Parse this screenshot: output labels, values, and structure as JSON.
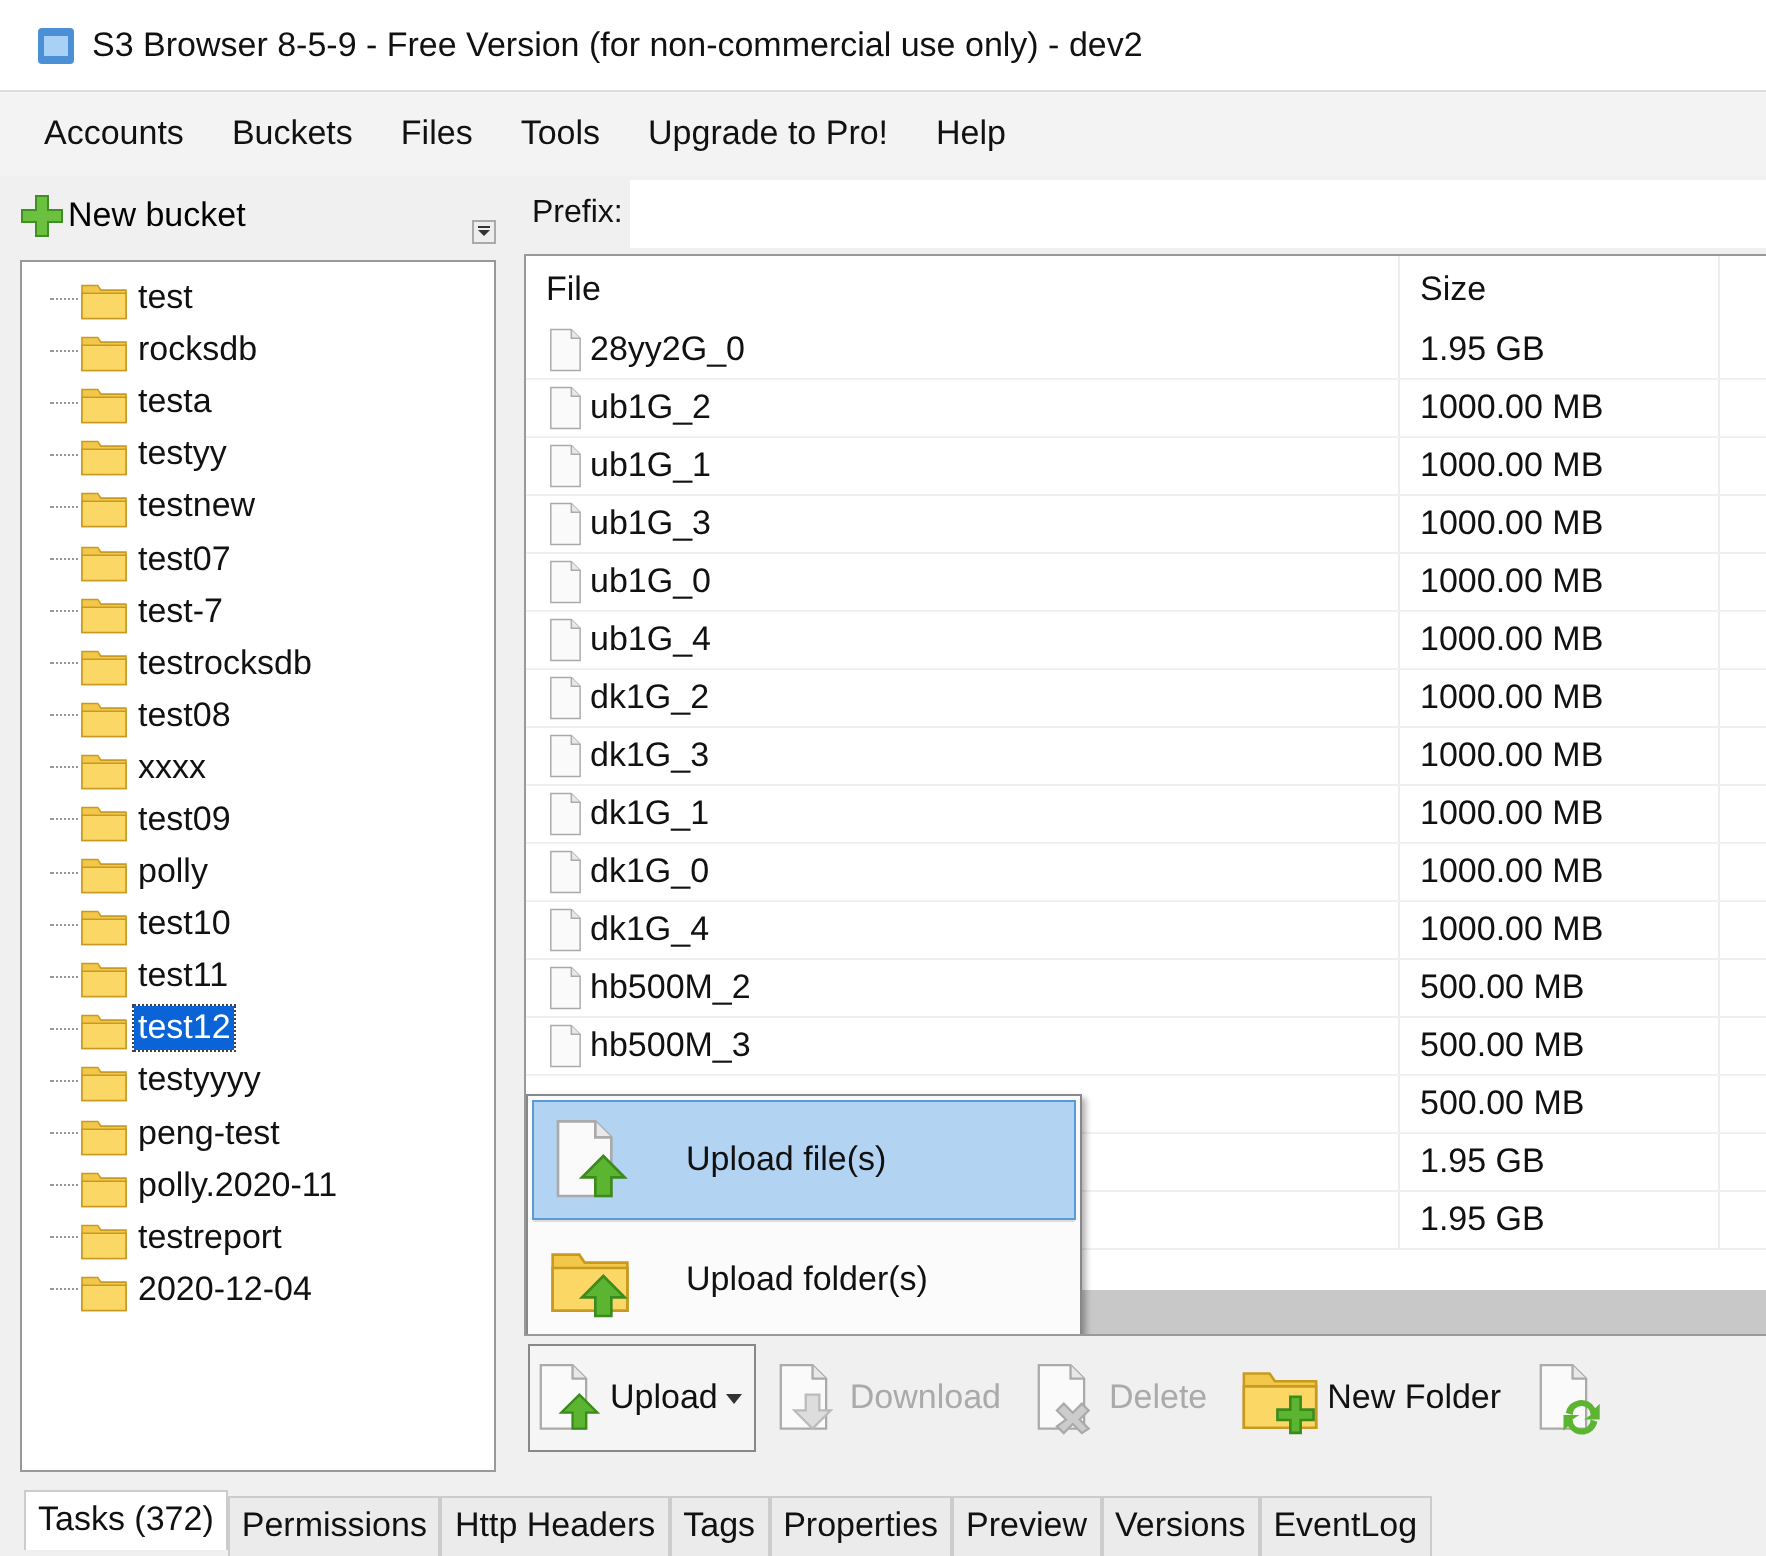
{
  "window": {
    "title": "S3 Browser 8-5-9 - Free Version (for non-commercial use only) - dev2"
  },
  "menu": [
    "Accounts",
    "Buckets",
    "Files",
    "Tools",
    "Upgrade to Pro!",
    "Help"
  ],
  "sidebar": {
    "new_bucket": "New bucket",
    "items": [
      {
        "label": "test",
        "selected": false
      },
      {
        "label": "rocksdb",
        "selected": false
      },
      {
        "label": "testa",
        "selected": false
      },
      {
        "label": "testyy",
        "selected": false
      },
      {
        "label": "testnew",
        "selected": false
      },
      {
        "label": "test07",
        "selected": false
      },
      {
        "label": "test-7",
        "selected": false
      },
      {
        "label": "testrocksdb",
        "selected": false
      },
      {
        "label": "test08",
        "selected": false
      },
      {
        "label": "xxxx",
        "selected": false
      },
      {
        "label": "test09",
        "selected": false
      },
      {
        "label": "polly",
        "selected": false
      },
      {
        "label": "test10",
        "selected": false
      },
      {
        "label": "test11",
        "selected": false
      },
      {
        "label": "test12",
        "selected": true
      },
      {
        "label": "testyyyy",
        "selected": false
      },
      {
        "label": "peng-test",
        "selected": false
      },
      {
        "label": "polly.2020-11",
        "selected": false
      },
      {
        "label": "testreport",
        "selected": false
      },
      {
        "label": "2020-12-04",
        "selected": false
      }
    ]
  },
  "prefix": {
    "label": "Prefix:"
  },
  "table": {
    "columns": [
      "File",
      "Size"
    ],
    "rows": [
      {
        "file": "28yy2G_0",
        "size": "1.95 GB"
      },
      {
        "file": "ub1G_2",
        "size": "1000.00 MB"
      },
      {
        "file": "ub1G_1",
        "size": "1000.00 MB"
      },
      {
        "file": "ub1G_3",
        "size": "1000.00 MB"
      },
      {
        "file": "ub1G_0",
        "size": "1000.00 MB"
      },
      {
        "file": "ub1G_4",
        "size": "1000.00 MB"
      },
      {
        "file": "dk1G_2",
        "size": "1000.00 MB"
      },
      {
        "file": "dk1G_3",
        "size": "1000.00 MB"
      },
      {
        "file": "dk1G_1",
        "size": "1000.00 MB"
      },
      {
        "file": "dk1G_0",
        "size": "1000.00 MB"
      },
      {
        "file": "dk1G_4",
        "size": "1000.00 MB"
      },
      {
        "file": "hb500M_2",
        "size": "500.00 MB"
      },
      {
        "file": "hb500M_3",
        "size": "500.00 MB"
      },
      {
        "size": "500.00 MB"
      },
      {
        "size": "1.95 GB"
      },
      {
        "size": "1.95 GB"
      }
    ]
  },
  "upload_menu": [
    {
      "label": "Upload file(s)",
      "kind": "file",
      "selected": true
    },
    {
      "label": "Upload folder(s)",
      "kind": "folder",
      "selected": false
    }
  ],
  "toolbar": [
    {
      "label": "Upload",
      "kind": "upload",
      "disabled": false
    },
    {
      "label": "Download",
      "kind": "download",
      "disabled": true
    },
    {
      "label": "Delete",
      "kind": "delete",
      "disabled": true
    },
    {
      "label": "New Folder",
      "kind": "newfolder",
      "disabled": false
    },
    {
      "kind": "refresh"
    }
  ],
  "tabs": [
    {
      "label": "Tasks (372)",
      "selected": true
    },
    {
      "label": "Permissions",
      "selected": false
    },
    {
      "label": "Http Headers",
      "selected": false
    },
    {
      "label": "Tags",
      "selected": false
    },
    {
      "label": "Properties",
      "selected": false
    },
    {
      "label": "Preview",
      "selected": false
    },
    {
      "label": "Versions",
      "selected": false
    },
    {
      "label": "EventLog",
      "selected": false
    }
  ]
}
